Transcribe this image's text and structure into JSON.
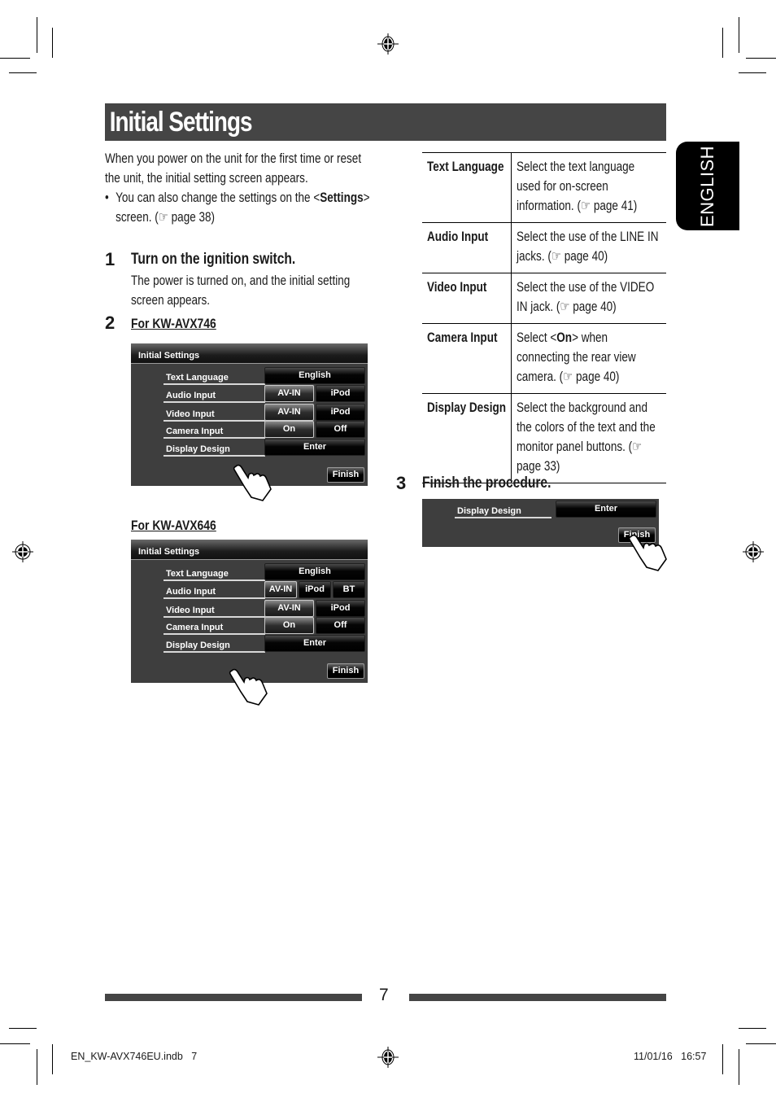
{
  "title": "Initial Settings",
  "language_tab": "ENGLISH",
  "intro": {
    "line1": "When you power on the unit for the first time or reset",
    "line2": "the unit, the initial setting screen appears.",
    "bullet_pre": "You can also change the settings on the <",
    "bullet_bold": "Settings",
    "bullet_post": ">",
    "bullet_line2": "screen. (☞ page 38)"
  },
  "steps": [
    {
      "number": "1",
      "title": "Turn on the ignition switch.",
      "line1": "The power is turned on, and the initial setting",
      "line2": "screen appears."
    },
    {
      "number": "2",
      "model_a": "For KW-AVX746",
      "model_b": "For KW-AVX646"
    },
    {
      "number": "3",
      "title": "Finish the procedure."
    }
  ],
  "screen_746": {
    "header": "Initial Settings",
    "rows": [
      {
        "label": "Text Language",
        "buttons": [
          "English"
        ],
        "selected": -1
      },
      {
        "label": "Audio Input",
        "buttons": [
          "AV-IN",
          "iPod"
        ],
        "selected": 0
      },
      {
        "label": "Video Input",
        "buttons": [
          "AV-IN",
          "iPod"
        ],
        "selected": 0
      },
      {
        "label": "Camera Input",
        "buttons": [
          "On",
          "Off"
        ],
        "selected": 0
      },
      {
        "label": "Display Design",
        "buttons": [
          "Enter"
        ],
        "selected": -1
      }
    ],
    "finish": "Finish"
  },
  "screen_646": {
    "header": "Initial Settings",
    "rows": [
      {
        "label": "Text Language",
        "buttons": [
          "English"
        ],
        "selected": -1
      },
      {
        "label": "Audio Input",
        "buttons": [
          "AV-IN",
          "iPod",
          "BT"
        ],
        "selected": 0
      },
      {
        "label": "Video Input",
        "buttons": [
          "AV-IN",
          "iPod"
        ],
        "selected": 0
      },
      {
        "label": "Camera Input",
        "buttons": [
          "On",
          "Off"
        ],
        "selected": 0
      },
      {
        "label": "Display Design",
        "buttons": [
          "Enter"
        ],
        "selected": -1
      }
    ],
    "finish": "Finish"
  },
  "screen_finish": {
    "row_label": "Display Design",
    "row_button": "Enter",
    "finish": "Finish"
  },
  "table": [
    {
      "term": "Text Language",
      "desc": "Select the text language used for on-screen information. (☞ page 41)"
    },
    {
      "term": "Audio Input",
      "desc": "Select the use of the LINE IN jacks. (☞ page 40)"
    },
    {
      "term": "Video Input",
      "desc": "Select the use of the VIDEO IN jack. (☞ page 40)"
    },
    {
      "term": "Camera Input",
      "desc_pre": "Select <",
      "desc_bold": "On",
      "desc_post": "> when connecting the rear view camera. (☞ page 40)"
    },
    {
      "term": "Display Design",
      "desc": "Select the background and the colors of the text and the monitor panel buttons. (☞ page 33)"
    }
  ],
  "page_number": "7",
  "slug": {
    "file": "EN_KW-AVX746EU.indb   7",
    "datetime": "11/01/16   16:57"
  },
  "colors": {
    "title_bar": "#454545",
    "screen_bg": "#3e3e3e",
    "tab_bg": "#000000"
  }
}
